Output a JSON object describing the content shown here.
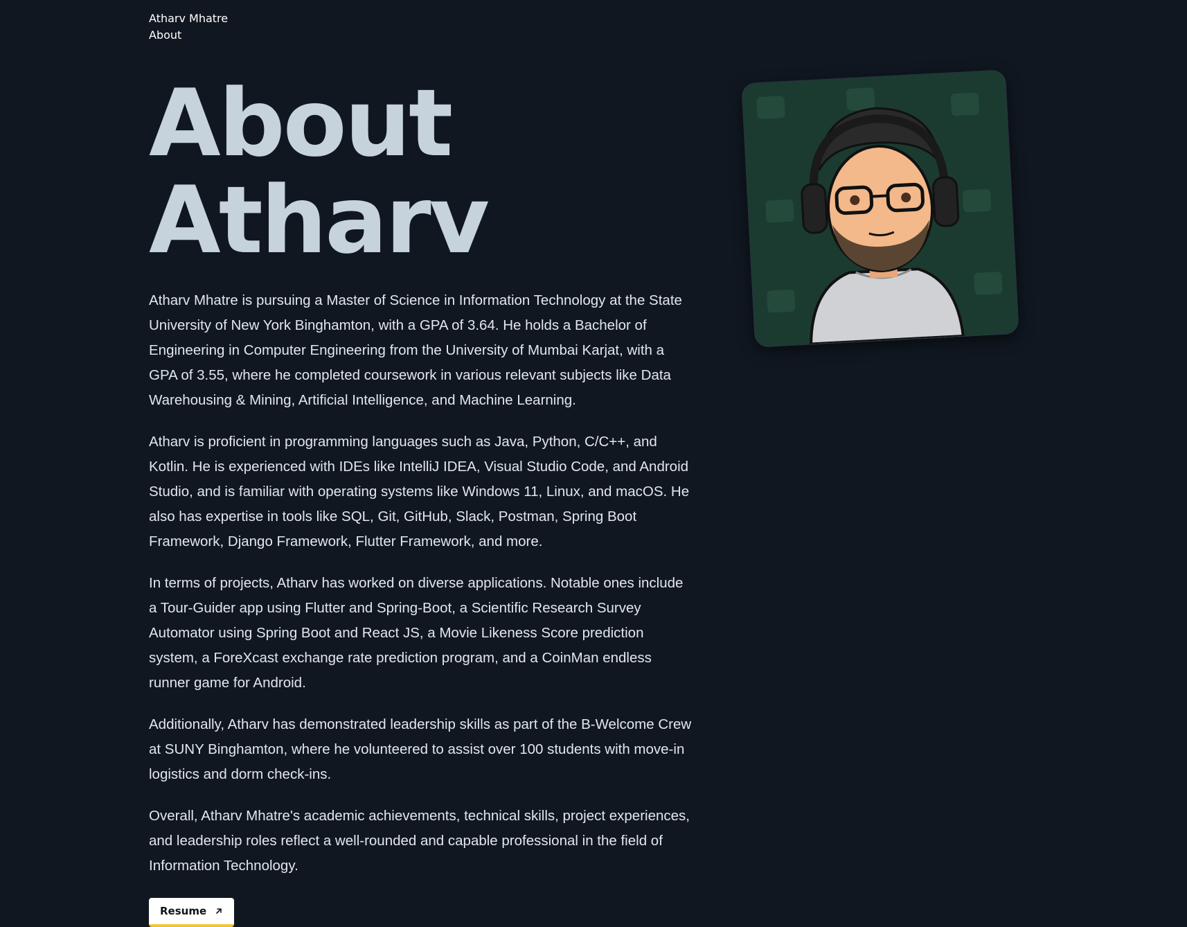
{
  "nav": {
    "site_name": "Atharv Mhatre",
    "about_link": "About"
  },
  "main": {
    "title": "About Atharv",
    "paragraphs": [
      "Atharv Mhatre is pursuing a Master of Science in Information Technology at the State University of New York Binghamton, with a GPA of 3.64. He holds a Bachelor of Engineering in Computer Engineering from the University of Mumbai Karjat, with a GPA of 3.55, where he completed coursework in various relevant subjects like Data Warehousing & Mining, Artificial Intelligence, and Machine Learning.",
      "Atharv is proficient in programming languages such as Java, Python, C/C++, and Kotlin. He is experienced with IDEs like IntelliJ IDEA, Visual Studio Code, and Android Studio, and is familiar with operating systems like Windows 11, Linux, and macOS. He also has expertise in tools like SQL, Git, GitHub, Slack, Postman, Spring Boot Framework, Django Framework, Flutter Framework, and more.",
      "In terms of projects, Atharv has worked on diverse applications. Notable ones include a Tour-Guider app using Flutter and Spring-Boot, a Scientific Research Survey Automator using Spring Boot and React JS, a Movie Likeness Score prediction system, a ForeXcast exchange rate prediction program, and a CoinMan endless runner game for Android.",
      "Additionally, Atharv has demonstrated leadership skills as part of the B-Welcome Crew at SUNY Binghamton, where he volunteered to assist over 100 students with move-in logistics and dorm check-ins.",
      "Overall, Atharv Mhatre's academic achievements, technical skills, project experiences, and leadership roles reflect a well-rounded and capable professional in the field of Information Technology."
    ],
    "resume_label": "Resume",
    "resume_icon": "arrow-up-right-icon"
  },
  "avatar": {
    "icon": "cartoon-avatar-with-headphones",
    "background_color": "#1c3b30"
  },
  "colors": {
    "page_background": "#101720",
    "title": "#c6d2dc",
    "body_text": "#e2e7ee",
    "button_underline": "#f4c430"
  }
}
